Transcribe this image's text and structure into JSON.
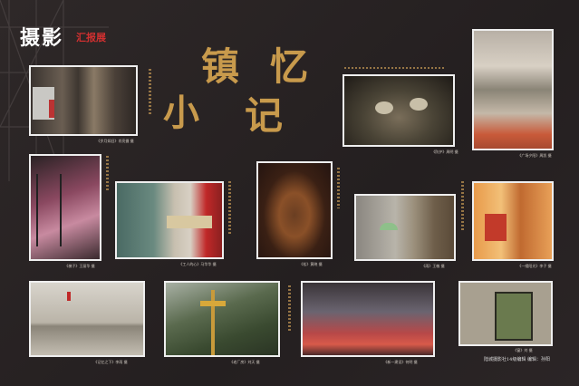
{
  "header": {
    "brand": "摄影",
    "brand_sub": "汇报展",
    "title_chars": [
      "小",
      "镇",
      "忆",
      "记"
    ]
  },
  "captions": {
    "p1": "《岁月如旧》肖亮摄 摄",
    "p2": "《梯子》王丽华 摄",
    "p3": "《工人的心》马华华 摄",
    "p4": "《松》黄晓 摄",
    "p5": "《雨》王敏 摄",
    "p6": "《一缕阳光》李子 摄",
    "p7": "《记忆之下》李雨 摄",
    "p8": "《老厂房》刘天 摄",
    "p9": "《新一建设》何明 摄",
    "p10": "《窗》刘 摄",
    "p11": "《防护》周明 摄",
    "p12": "《广场夕阳》周凯 摄"
  },
  "footer": {
    "credit": "陆城摄影社14级编辑   编辑：孙阳"
  }
}
